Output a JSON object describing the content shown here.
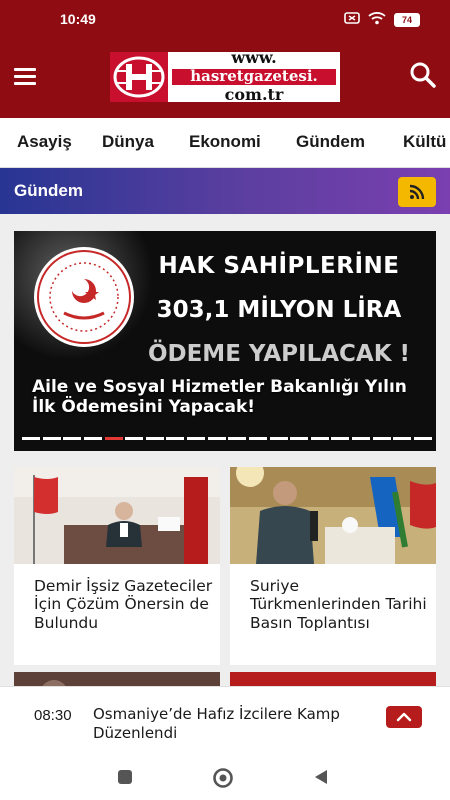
{
  "status_bar": {
    "time": "10:49",
    "battery": "74",
    "icons": [
      "sim-x-icon",
      "wifi-icon",
      "battery-icon"
    ]
  },
  "header": {
    "logo_line1": "www.",
    "logo_line2": "hasretgazetesi.",
    "logo_line3": "com.tr",
    "menu_icon": "hamburger-menu-icon",
    "search_icon": "search-icon",
    "colors": {
      "header_bg": "#8f0d12",
      "logo_red": "#c8102e"
    }
  },
  "tabs": [
    "Asayiş",
    "Dünya",
    "Ekonomi",
    "Gündem",
    "Kültü"
  ],
  "section": {
    "title": "Gündem",
    "rss_icon": "rss-icon",
    "colors": {
      "gradient_start": "#283593",
      "gradient_end": "#7b3fb0",
      "rss_bg": "#f5b800"
    }
  },
  "slider": {
    "banner_line1": "HAK SAHİPLERİNE",
    "banner_line2": "303,1 MİLYON LİRA",
    "banner_line3": "ÖDEME YAPILACAK !",
    "caption": "Aile ve Sosyal Hizmetler Bakanlığı Yılın İlk Ödemesini Yapacak!",
    "dot_count": 20,
    "active_dot": 5
  },
  "cards": [
    {
      "title": "Demir İşsiz Gazeteciler İçin Çözüm Önersin de Bulundu"
    },
    {
      "title": "Suriye Türkmenlerinden Tarihi Basın Toplantısı"
    }
  ],
  "breaking": {
    "time": "08:30",
    "text": "Osmaniye’de Hafız İzcilere Kamp Düzenlendi",
    "up_icon": "chevron-up-icon"
  },
  "nav": [
    "recent-apps-icon",
    "home-icon",
    "back-icon"
  ]
}
